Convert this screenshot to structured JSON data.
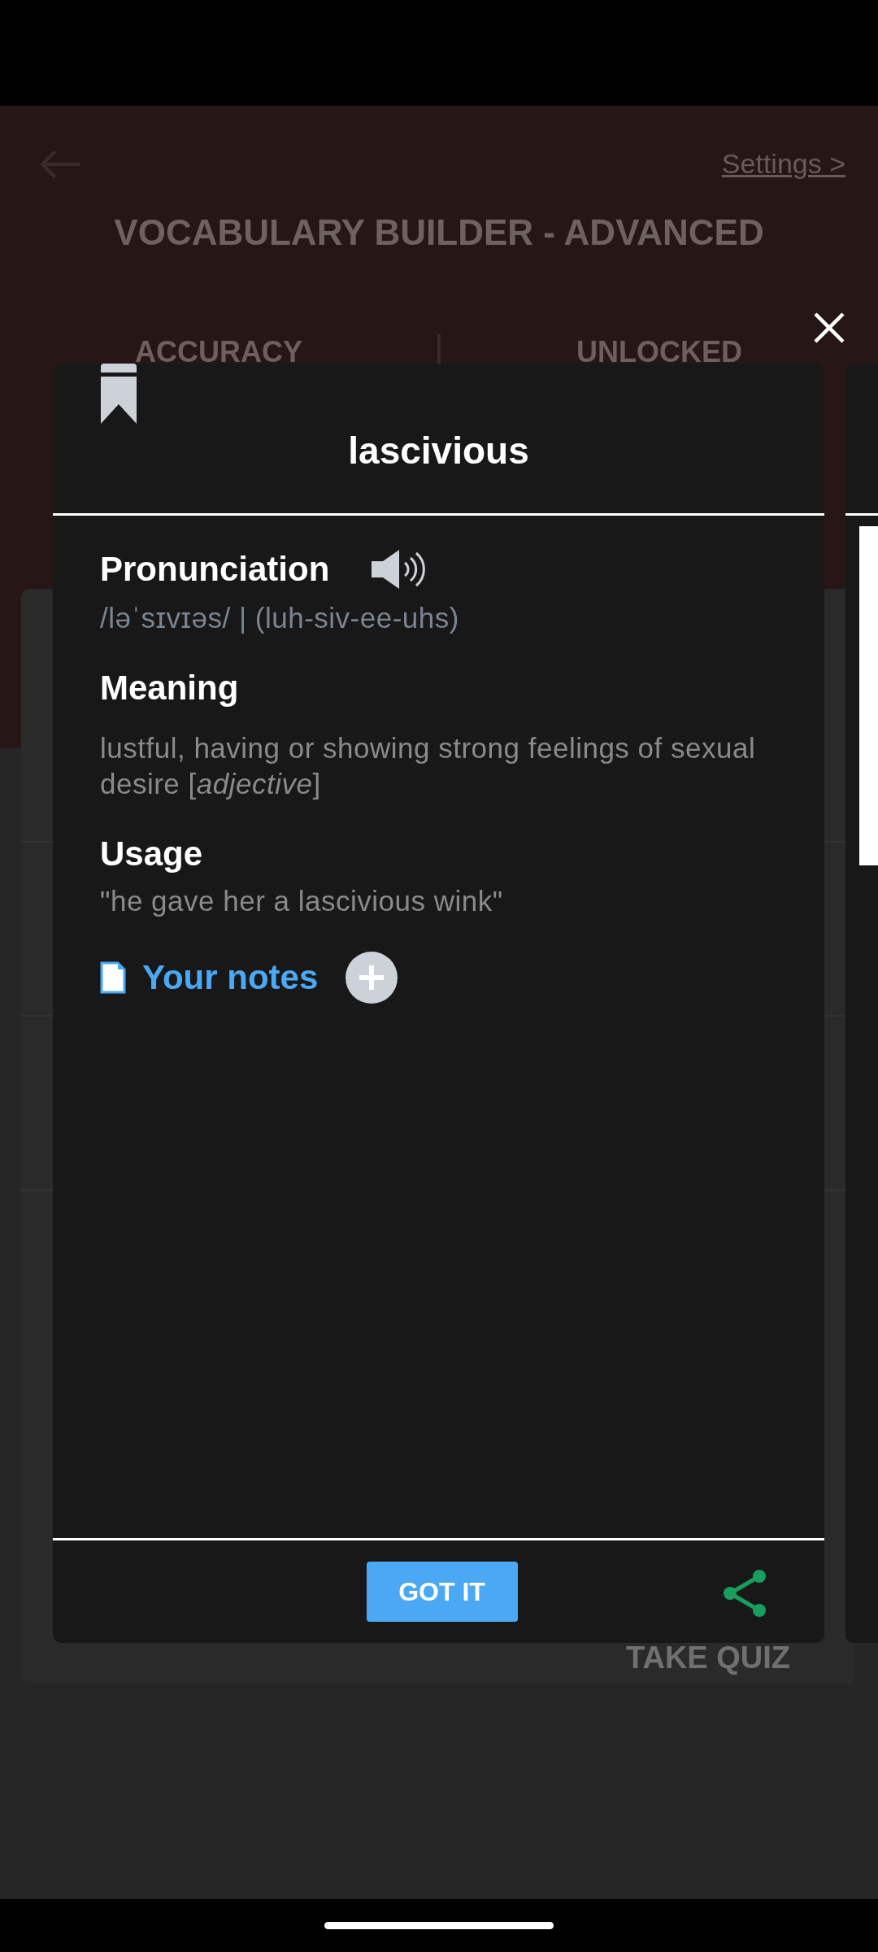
{
  "background_page": {
    "settings_link": "Settings >",
    "title": "VOCABULARY BUILDER - ADVANCED",
    "stats": [
      "ACCURACY",
      "UNLOCKED"
    ],
    "quiz_button": "TAKE QUIZ"
  },
  "card": {
    "word": "lascivious",
    "sections": [
      {
        "kind": "pronunciation",
        "heading": "Pronunciation",
        "text": "/ləˈsɪvɪəs/ | (luh-siv-ee-uhs)"
      },
      {
        "kind": "meaning",
        "heading": "Meaning",
        "text": "lustful, having or showing strong feelings of sexual desire [*adjective*]"
      },
      {
        "kind": "usage",
        "heading": "Usage",
        "text": "\"he gave her a lascivious wink\""
      }
    ],
    "notes_label": "Your notes",
    "confirm_button": "GOT IT"
  }
}
